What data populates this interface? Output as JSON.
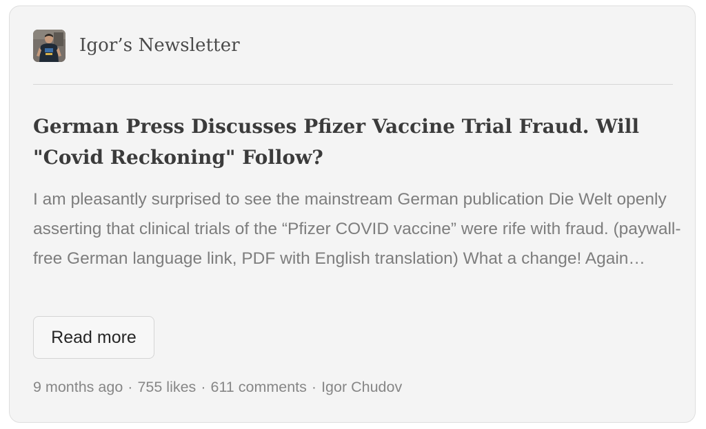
{
  "post": {
    "publication_name": "Igor’s Newsletter",
    "title": "German Press Discusses Pfizer Vaccine Trial Fraud. Will \"Covid Reckoning\" Follow?",
    "excerpt": "I am pleasantly surprised to see the mainstream German publication Die Welt openly asserting that clinical trials of the “Pfizer COVID vaccine” were rife with fraud. (paywall-free German language link, PDF with English translation) What a change! Again…",
    "read_more_label": "Read more",
    "meta": {
      "time_ago": "9 months ago",
      "likes": "755 likes",
      "comments": "611 comments",
      "author": "Igor Chudov",
      "separator": "·"
    }
  },
  "colors": {
    "card_background": "#f4f4f4",
    "title_text": "#3b3b3b",
    "excerpt_text": "#7d7d7d",
    "meta_text": "#868686"
  },
  "icons": {
    "avatar": "publication-avatar-photo"
  }
}
